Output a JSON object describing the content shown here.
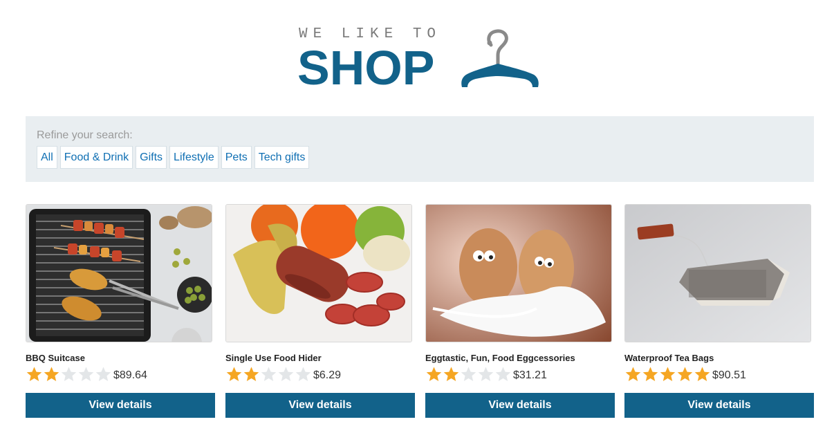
{
  "logo": {
    "tagline": "WE LIKE TO",
    "word": "SHOP"
  },
  "filters": {
    "label": "Refine your search:",
    "categories": [
      "All",
      "Food & Drink",
      "Gifts",
      "Lifestyle",
      "Pets",
      "Tech gifts"
    ]
  },
  "products": [
    {
      "name": "BBQ Suitcase",
      "rating": 2,
      "max_rating": 5,
      "price": "$89.64",
      "button": "View details"
    },
    {
      "name": "Single Use Food Hider",
      "rating": 2,
      "max_rating": 5,
      "price": "$6.29",
      "button": "View details"
    },
    {
      "name": "Eggtastic, Fun, Food Eggcessories",
      "rating": 2,
      "max_rating": 5,
      "price": "$31.21",
      "button": "View details"
    },
    {
      "name": "Waterproof Tea Bags",
      "rating": 5,
      "max_rating": 5,
      "price": "$90.51",
      "button": "View details"
    }
  ],
  "colors": {
    "brand": "#12628a",
    "link": "#0f6fb3",
    "star_filled": "#f5a623",
    "star_empty": "#e3e6e8",
    "panel_bg": "#e9eef1"
  }
}
